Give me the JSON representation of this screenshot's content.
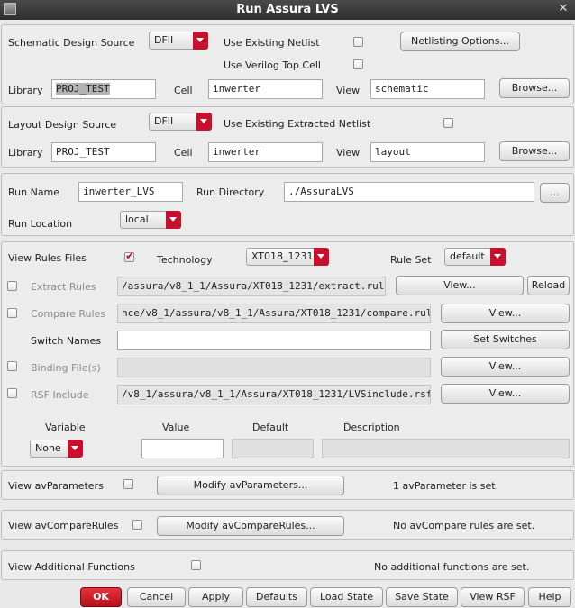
{
  "window": {
    "title": "Run Assura LVS"
  },
  "schematic": {
    "source_label": "Schematic Design Source",
    "source_value": "DFII",
    "use_netlist_label": "Use Existing Netlist",
    "netlisting_options_label": "Netlisting Options...",
    "verilog_label": "Use Verilog Top Cell",
    "library_label": "Library",
    "library_value": "PROJ_TEST",
    "cell_label": "Cell",
    "cell_value": "inwerter",
    "view_label": "View",
    "view_value": "schematic",
    "browse_label": "Browse..."
  },
  "layout": {
    "source_label": "Layout Design Source",
    "source_value": "DFII",
    "use_extracted_label": "Use Existing Extracted Netlist",
    "library_label": "Library",
    "library_value": "PROJ_TEST",
    "cell_label": "Cell",
    "cell_value": "inwerter",
    "view_label": "View",
    "view_value": "layout",
    "browse_label": "Browse..."
  },
  "run": {
    "name_label": "Run Name",
    "name_value": "inwerter_LVS",
    "dir_label": "Run Directory",
    "dir_value": "./AssuraLVS",
    "dir_browse_label": "...",
    "location_label": "Run Location",
    "location_value": "local"
  },
  "rules": {
    "view_rules_label": "View Rules Files",
    "technology_label": "Technology",
    "technology_value": "XT018_1231",
    "ruleset_label": "Rule Set",
    "ruleset_value": "default",
    "extract_label": "Extract Rules",
    "extract_value": "/assura/v8_1_1/Assura/XT018_1231/extract.rul",
    "extract_view_label": "View...",
    "reload_label": "Reload",
    "compare_label": "Compare Rules",
    "compare_value": "nce/v8_1/assura/v8_1_1/Assura/XT018_1231/compare.rul",
    "compare_view_label": "View...",
    "switch_label": "Switch Names",
    "set_switches_label": "Set Switches",
    "binding_label": "Binding File(s)",
    "binding_view_label": "View...",
    "rsf_label": "RSF Include",
    "rsf_value": "/v8_1/assura/v8_1_1/Assura/XT018_1231/LVSinclude.rsf",
    "rsf_view_label": "View...",
    "variable_header": "Variable",
    "value_header": "Value",
    "default_header": "Default",
    "description_header": "Description",
    "variable_value": "None"
  },
  "avparams": {
    "label": "View avParameters",
    "button": "Modify avParameters...",
    "status": "1 avParameter is set."
  },
  "avcompare": {
    "label": "View avCompareRules",
    "button": "Modify avCompareRules...",
    "status": "No avCompare rules are set."
  },
  "additional": {
    "label": "View Additional Functions",
    "status": "No additional functions are set."
  },
  "footer": {
    "ok": "OK",
    "cancel": "Cancel",
    "apply": "Apply",
    "defaults": "Defaults",
    "load_state": "Load State",
    "save_state": "Save State",
    "view_rsf": "View RSF",
    "help": "Help"
  },
  "colors": {
    "accent": "#c8102e",
    "background": "#e9e9e9",
    "titlebar": "#3a3a3a"
  }
}
